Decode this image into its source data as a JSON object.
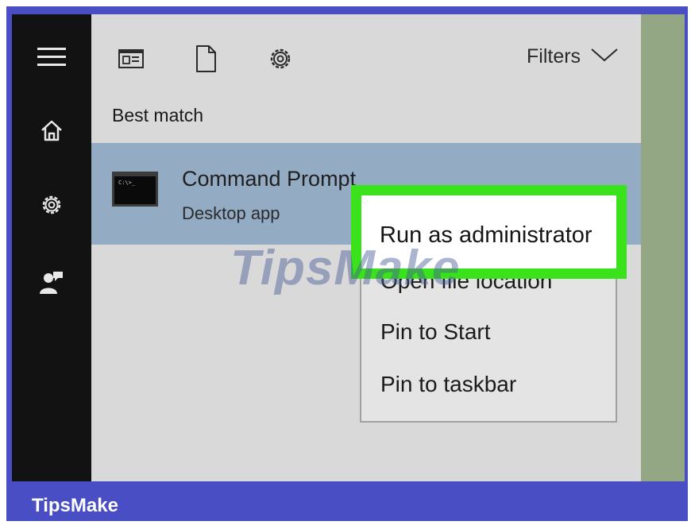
{
  "toolbar": {
    "filters_label": "Filters"
  },
  "results": {
    "section_header": "Best match",
    "item": {
      "title": "Command Prompt",
      "subtitle": "Desktop app"
    }
  },
  "context_menu": {
    "items": [
      "Run as administrator",
      "Open file location",
      "Pin to Start",
      "Pin to taskbar"
    ]
  },
  "watermark": "TipsMake",
  "brand": "TipsMake",
  "colors": {
    "frame": "#4a4ec4",
    "sidebar": "#121212",
    "panel": "#d9d9d9",
    "selected_result": "#93acc4",
    "highlight_border": "#39e21a",
    "desktop_strip": "#94a784"
  },
  "icons": {
    "sidebar": [
      "hamburger-menu-icon",
      "home-icon",
      "settings-gear-icon",
      "user-feedback-icon"
    ],
    "toolbar": [
      "apps-filter-icon",
      "document-filter-icon",
      "settings-filter-icon",
      "chevron-down-icon"
    ],
    "result": "command-prompt-icon"
  }
}
